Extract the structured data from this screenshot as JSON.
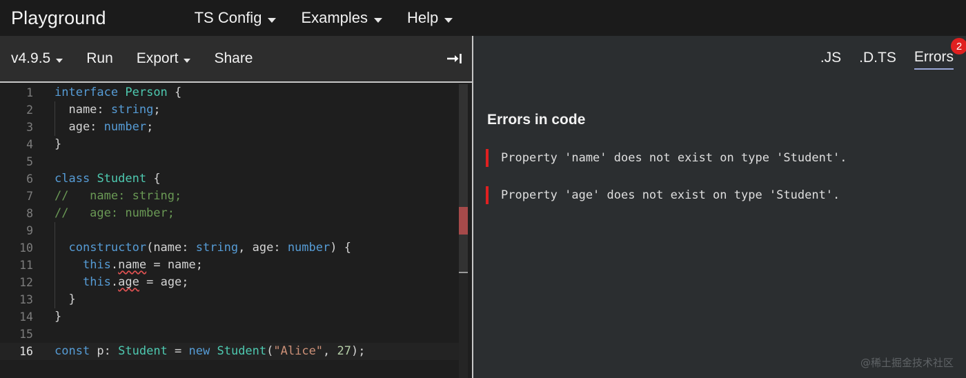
{
  "nav": {
    "brand": "Playground",
    "menus": [
      {
        "label": "TS Config",
        "caret": "chevron-down-icon"
      },
      {
        "label": "Examples",
        "caret": "chevron-down-icon"
      },
      {
        "label": "Help",
        "caret": "chevron-down-icon"
      }
    ]
  },
  "toolbar": {
    "version": "v4.9.5",
    "run_label": "Run",
    "export_label": "Export",
    "share_label": "Share",
    "collapse_icon": "arrow-right-to-bar-icon"
  },
  "editor": {
    "language": "typescript",
    "active_line": 16,
    "lines": [
      {
        "n": "1",
        "tokens": [
          {
            "t": "kw",
            "v": "interface"
          },
          {
            "t": "plain",
            "v": " "
          },
          {
            "t": "type",
            "v": "Person"
          },
          {
            "t": "plain",
            "v": " {"
          }
        ]
      },
      {
        "n": "2",
        "guide": true,
        "tokens": [
          {
            "t": "plain",
            "v": "  name: "
          },
          {
            "t": "kw",
            "v": "string"
          },
          {
            "t": "plain",
            "v": ";"
          }
        ]
      },
      {
        "n": "3",
        "guide": true,
        "tokens": [
          {
            "t": "plain",
            "v": "  age: "
          },
          {
            "t": "kw",
            "v": "number"
          },
          {
            "t": "plain",
            "v": ";"
          }
        ]
      },
      {
        "n": "4",
        "tokens": [
          {
            "t": "plain",
            "v": "}"
          }
        ]
      },
      {
        "n": "5",
        "tokens": []
      },
      {
        "n": "6",
        "tokens": [
          {
            "t": "kw",
            "v": "class"
          },
          {
            "t": "plain",
            "v": " "
          },
          {
            "t": "type",
            "v": "Student"
          },
          {
            "t": "plain",
            "v": " {"
          }
        ]
      },
      {
        "n": "7",
        "tokens": [
          {
            "t": "cmt",
            "v": "//   name: string;"
          }
        ]
      },
      {
        "n": "8",
        "tokens": [
          {
            "t": "cmt",
            "v": "//   age: number;"
          }
        ]
      },
      {
        "n": "9",
        "guide": true,
        "tokens": []
      },
      {
        "n": "10",
        "guide": true,
        "tokens": [
          {
            "t": "plain",
            "v": "  "
          },
          {
            "t": "fn",
            "v": "constructor"
          },
          {
            "t": "plain",
            "v": "(name: "
          },
          {
            "t": "kw",
            "v": "string"
          },
          {
            "t": "plain",
            "v": ", age: "
          },
          {
            "t": "kw",
            "v": "number"
          },
          {
            "t": "plain",
            "v": ") {"
          }
        ]
      },
      {
        "n": "11",
        "guide": true,
        "tokens": [
          {
            "t": "plain",
            "v": "    "
          },
          {
            "t": "kw",
            "v": "this"
          },
          {
            "t": "plain",
            "v": "."
          },
          {
            "t": "err",
            "v": "name"
          },
          {
            "t": "plain",
            "v": " = name;"
          }
        ]
      },
      {
        "n": "12",
        "guide": true,
        "tokens": [
          {
            "t": "plain",
            "v": "    "
          },
          {
            "t": "kw",
            "v": "this"
          },
          {
            "t": "plain",
            "v": "."
          },
          {
            "t": "err",
            "v": "age"
          },
          {
            "t": "plain",
            "v": " = age;"
          }
        ]
      },
      {
        "n": "13",
        "guide": true,
        "tokens": [
          {
            "t": "plain",
            "v": "  }"
          }
        ]
      },
      {
        "n": "14",
        "tokens": [
          {
            "t": "plain",
            "v": "}"
          }
        ]
      },
      {
        "n": "15",
        "tokens": []
      },
      {
        "n": "16",
        "active": true,
        "tokens": [
          {
            "t": "kw",
            "v": "const"
          },
          {
            "t": "plain",
            "v": " p: "
          },
          {
            "t": "type",
            "v": "Student"
          },
          {
            "t": "plain",
            "v": " = "
          },
          {
            "t": "kw",
            "v": "new"
          },
          {
            "t": "plain",
            "v": " "
          },
          {
            "t": "type",
            "v": "Student"
          },
          {
            "t": "plain",
            "v": "("
          },
          {
            "t": "str",
            "v": "\"Alice\""
          },
          {
            "t": "plain",
            "v": ", "
          },
          {
            "t": "num",
            "v": "27"
          },
          {
            "t": "plain",
            "v": ");"
          }
        ]
      }
    ]
  },
  "right_panel": {
    "tabs": [
      {
        "label": ".JS",
        "active": false
      },
      {
        "label": ".D.TS",
        "active": false
      },
      {
        "label": "Errors",
        "active": true,
        "badge": "2"
      }
    ],
    "errors_heading": "Errors in code",
    "errors": [
      "Property 'name' does not exist on type 'Student'.",
      "Property 'age' does not exist on type 'Student'."
    ]
  },
  "watermark": "@稀土掘金技术社区",
  "colors": {
    "accent_blue": "#569cd6",
    "type_teal": "#4ec9b0",
    "comment_green": "#6a9955",
    "string_orange": "#ce9178",
    "number_green": "#b5cea8",
    "error_red": "#e02020",
    "tab_underline": "#9aa7d8",
    "editor_bg": "#1e1e1e",
    "panel_bg": "#2b2e30",
    "nav_bg": "#1b1b1b",
    "toolbar_bg": "#2d2d2d"
  }
}
